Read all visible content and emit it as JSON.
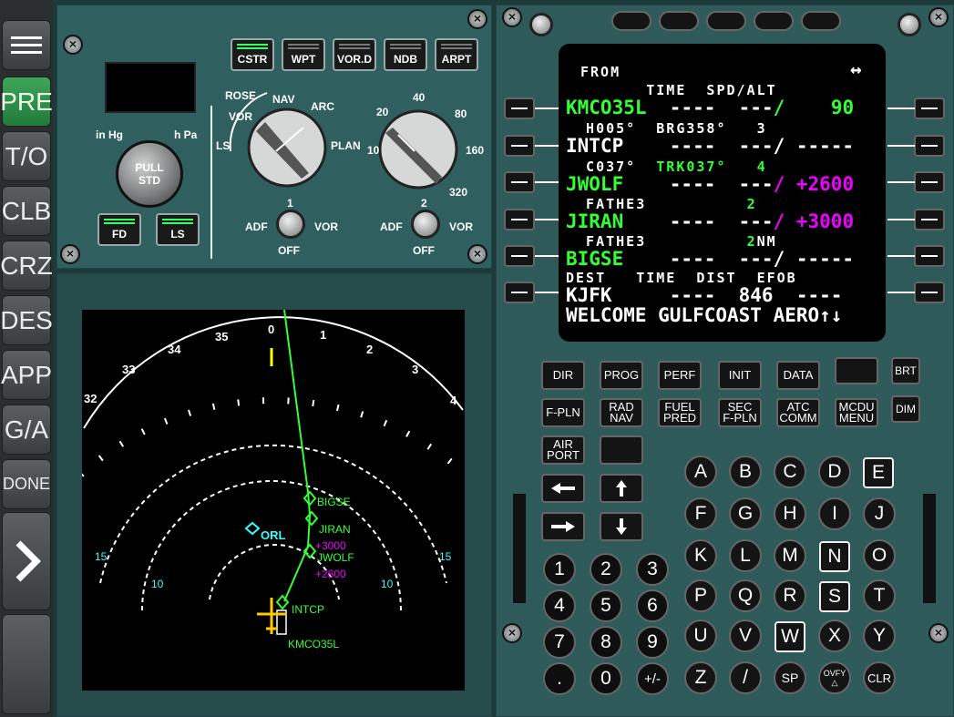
{
  "sidebar": {
    "menu_icon": "hamburger-icon",
    "phases": [
      "PRE",
      "T/O",
      "CLB",
      "CRZ",
      "DES",
      "APP",
      "G/A",
      "DONE"
    ],
    "selected": "PRE",
    "next_icon": "chevron-right-icon"
  },
  "efis": {
    "top_buttons": [
      "CSTR",
      "WPT",
      "VOR.D",
      "NDB",
      "ARPT"
    ],
    "baro": {
      "left": "in Hg",
      "right": "h Pa",
      "knob": "PULL\nSTD",
      "knob_line1": "PULL",
      "knob_line2": "STD"
    },
    "fd_ls": [
      "FD",
      "LS"
    ],
    "mode": {
      "labels": [
        "ROSE",
        "NAV",
        "ARC",
        "VOR",
        "LS",
        "PLAN"
      ]
    },
    "range": {
      "labels": [
        "10",
        "20",
        "40",
        "80",
        "160",
        "320"
      ]
    },
    "adf1": {
      "left": "ADF",
      "num": "1",
      "right": "VOR",
      "bottom": "OFF"
    },
    "adf2": {
      "left": "ADF",
      "num": "2",
      "right": "VOR",
      "bottom": "OFF"
    }
  },
  "mcdu": {
    "header": {
      "title": "FROM",
      "arrows": "↔"
    },
    "lines": [
      {
        "small": "      TIME  SPD/ALT",
        "big": "KMCO35L  ----  ---/    90"
      },
      {
        "small": "H005°  BRG358°   3",
        "big": "INTCP    ----  ---/ -----"
      },
      {
        "small": "C037°  TRK037°   4",
        "big": "JWOLF    ----  ---/ +2600"
      },
      {
        "small": "FATHE3          2",
        "big": "JIRAN    ----  ---/ +3000"
      },
      {
        "small": "FATHE3          2NM",
        "big": "BIGSE    ----  ---/ -----"
      },
      {
        "small": "DEST   TIME  DIST  EFOB",
        "big": "KJFK     ----  846  ----"
      }
    ],
    "scratchpad": "WELCOME GULFCOAST AERO↑↓",
    "fn_row1": [
      "DIR",
      "PROG",
      "PERF",
      "INIT",
      "DATA"
    ],
    "fn_row2": [
      "F-PLN",
      "RAD\nNAV",
      "FUEL\nPRED",
      "SEC\nF-PLN",
      "ATC\nCOMM",
      "MCDU\nMENU"
    ],
    "brt": "BRT",
    "dim": "DIM",
    "airport": "AIR\nPORT",
    "letters": [
      "A",
      "B",
      "C",
      "D",
      "E",
      "F",
      "G",
      "H",
      "I",
      "J",
      "K",
      "L",
      "M",
      "N",
      "O",
      "P",
      "Q",
      "R",
      "S",
      "T",
      "U",
      "V",
      "W",
      "X",
      "Y",
      "Z",
      "/",
      "SP",
      "OVFY",
      "CLR"
    ],
    "numbers": [
      "1",
      "2",
      "3",
      "4",
      "5",
      "6",
      "7",
      "8",
      "9",
      ".",
      "0",
      "+/-"
    ]
  },
  "nd": {
    "headings": [
      "32",
      "33",
      "34",
      "35",
      "0",
      "1",
      "2",
      "3",
      "4"
    ],
    "ranges": [
      "15",
      "10",
      "10",
      "15"
    ],
    "waypoints": [
      "BIGSE",
      "JIRAN",
      "+3000",
      "JWOLF",
      "+2600",
      "INTCP",
      "KMCO35L"
    ],
    "navaid": "ORL"
  },
  "colors": {
    "green": "#33ff33",
    "magenta": "#ee00ff",
    "cyan": "#33ffff",
    "panel": "#2f5f5e"
  }
}
